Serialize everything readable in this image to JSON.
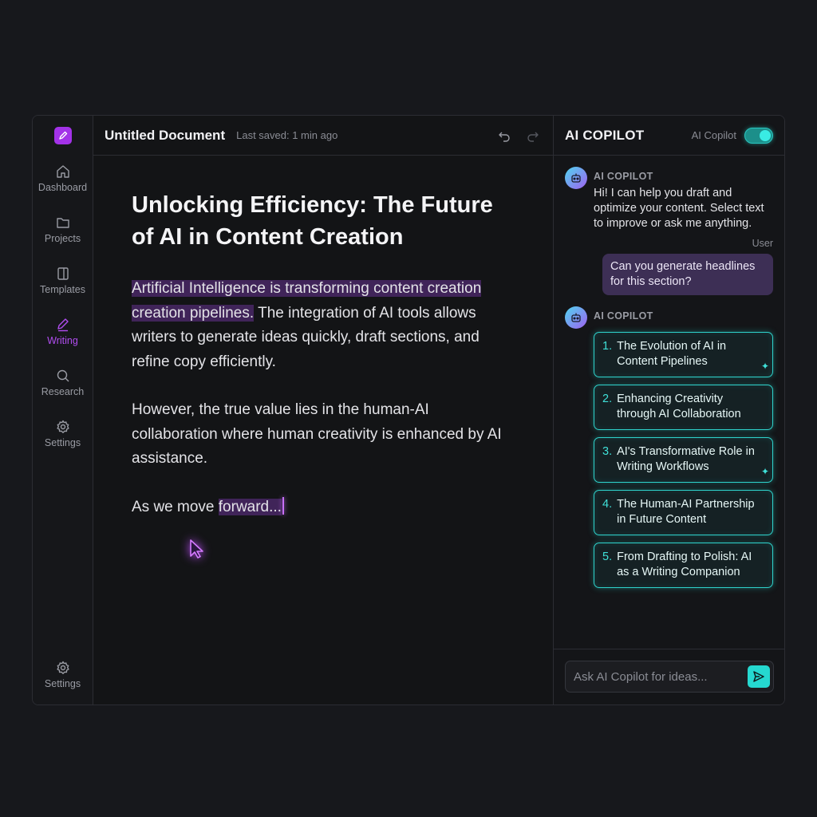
{
  "sidebar": {
    "items": [
      {
        "label": "Dashboard",
        "icon": "home-icon"
      },
      {
        "label": "Projects",
        "icon": "folder-icon"
      },
      {
        "label": "Templates",
        "icon": "template-icon"
      },
      {
        "label": "Writing",
        "icon": "pen-icon",
        "active": true
      },
      {
        "label": "Research",
        "icon": "search-icon"
      },
      {
        "label": "Settings",
        "icon": "gear-icon"
      }
    ],
    "bottom_label": "Settings"
  },
  "editor": {
    "doc_title": "Untitled Document",
    "saved": "Last saved: 1 min ago",
    "title": "Unlocking Efficiency: The Future of AI in Content Creation",
    "p1_highlight": "Artificial Intelligence is transforming content creation creation pipelines.",
    "p1_rest": " The integration of AI tools allows writers to generate ideas quickly, draft sections, and refine copy efficiently.",
    "p2": "However, the true value lies in the human-AI collaboration where human creativity is enhanced by AI assistance.",
    "p3_start": "As we move ",
    "p3_highlight": "forward..."
  },
  "copilot": {
    "title": "AI COPILOT",
    "toggle_label": "AI Copilot",
    "toggle_on": true,
    "ai_name": "AI COPILOT",
    "greeting": "Hi! I can help you draft and optimize your content. Select text to improve or ask me anything.",
    "user_label": "User",
    "user_message": "Can you generate headlines for this section?",
    "suggestions": [
      {
        "num": "1.",
        "text": "The Evolution of AI in Content Pipelines"
      },
      {
        "num": "2.",
        "text": "Enhancing Creativity through AI Collaboration"
      },
      {
        "num": "3.",
        "text": "AI's Transformative Role in Writing Workflows"
      },
      {
        "num": "4.",
        "text": "The Human-AI Partnership in Future Content"
      },
      {
        "num": "5.",
        "text": "From Drafting to Polish: AI as a Writing Companion"
      }
    ],
    "input_placeholder": "Ask AI Copilot for ideas..."
  },
  "colors": {
    "accent_purple": "#a332e8",
    "accent_teal": "#2fd3cc",
    "background": "#17181c"
  }
}
